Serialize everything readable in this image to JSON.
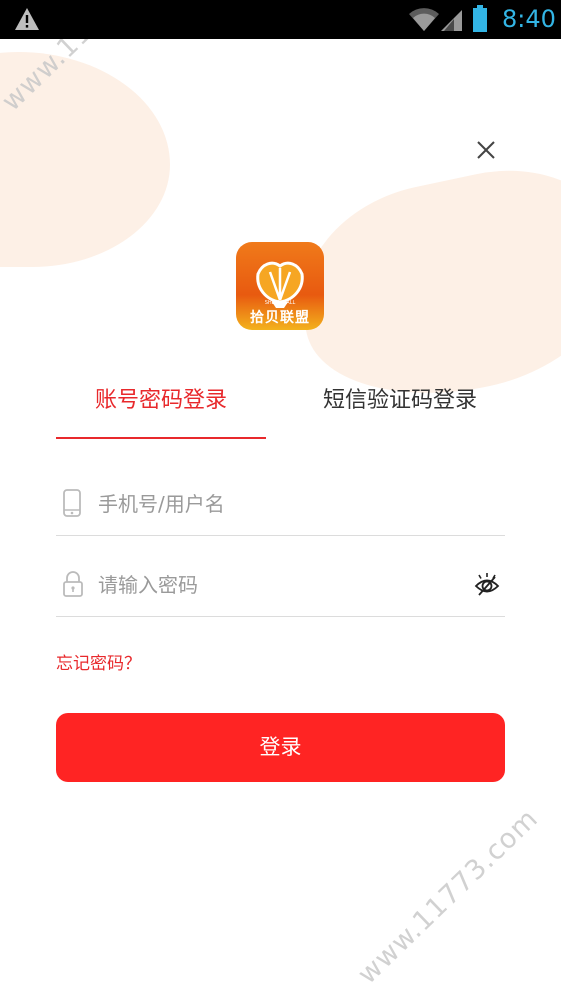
{
  "status_bar": {
    "time": "8:40",
    "icons": [
      "warning-icon",
      "wifi-icon",
      "signal-icon",
      "battery-icon"
    ],
    "text_color": "#33b5e5"
  },
  "watermark": {
    "text": "www.11773.com"
  },
  "header": {
    "close_icon": "close-icon"
  },
  "logo": {
    "name": "拾贝联盟",
    "sub": "SHELL MALL"
  },
  "tabs": [
    {
      "label": "账号密码登录",
      "active": true
    },
    {
      "label": "短信验证码登录",
      "active": false
    }
  ],
  "form": {
    "phone": {
      "placeholder": "手机号/用户名",
      "value": "",
      "icon": "phone-icon"
    },
    "password": {
      "placeholder": "请输入密码",
      "value": "",
      "icon": "lock-icon",
      "toggle_icon": "eye-hidden-icon"
    },
    "forgot_label": "忘记密码？",
    "submit_label": "登录"
  },
  "colors": {
    "accent": "#e8292c",
    "button": "#ff2423",
    "blob": "#fdf0e6"
  }
}
